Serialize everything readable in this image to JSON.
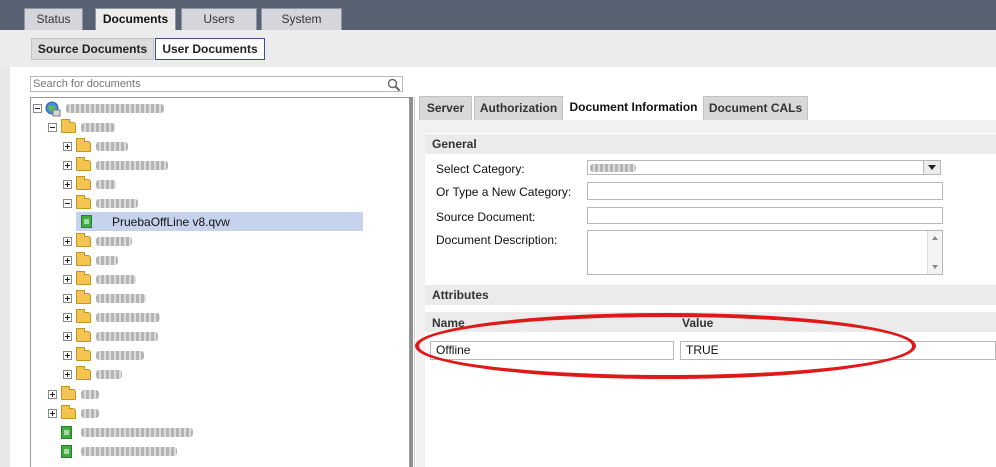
{
  "main_tabs": [
    {
      "label": "Status",
      "active": false
    },
    {
      "label": "Documents",
      "active": true
    },
    {
      "label": "Users",
      "active": false
    },
    {
      "label": "System",
      "active": false
    }
  ],
  "sub_tabs": [
    {
      "label": "Source Documents",
      "active": false
    },
    {
      "label": "User Documents",
      "active": true
    }
  ],
  "search": {
    "placeholder": "Search for documents"
  },
  "tree": {
    "selected_document": "PruebaOffLine v8.qvw"
  },
  "right_tabs": [
    {
      "label": "Server",
      "active": false
    },
    {
      "label": "Authorization",
      "active": false
    },
    {
      "label": "Document Information",
      "active": true
    },
    {
      "label": "Document CALs",
      "active": false
    }
  ],
  "general": {
    "heading": "General",
    "select_category_label": "Select Category:",
    "new_category_label": "Or Type a New Category:",
    "source_document_label": "Source Document:",
    "description_label": "Document Description:"
  },
  "attributes": {
    "heading": "Attributes",
    "name_header": "Name",
    "value_header": "Value",
    "rows": [
      {
        "name": "Offline",
        "value": "TRUE"
      }
    ]
  },
  "colors": {
    "topbar": "#596273",
    "annotation": "#e01818",
    "selection": "#c6d3ec"
  }
}
